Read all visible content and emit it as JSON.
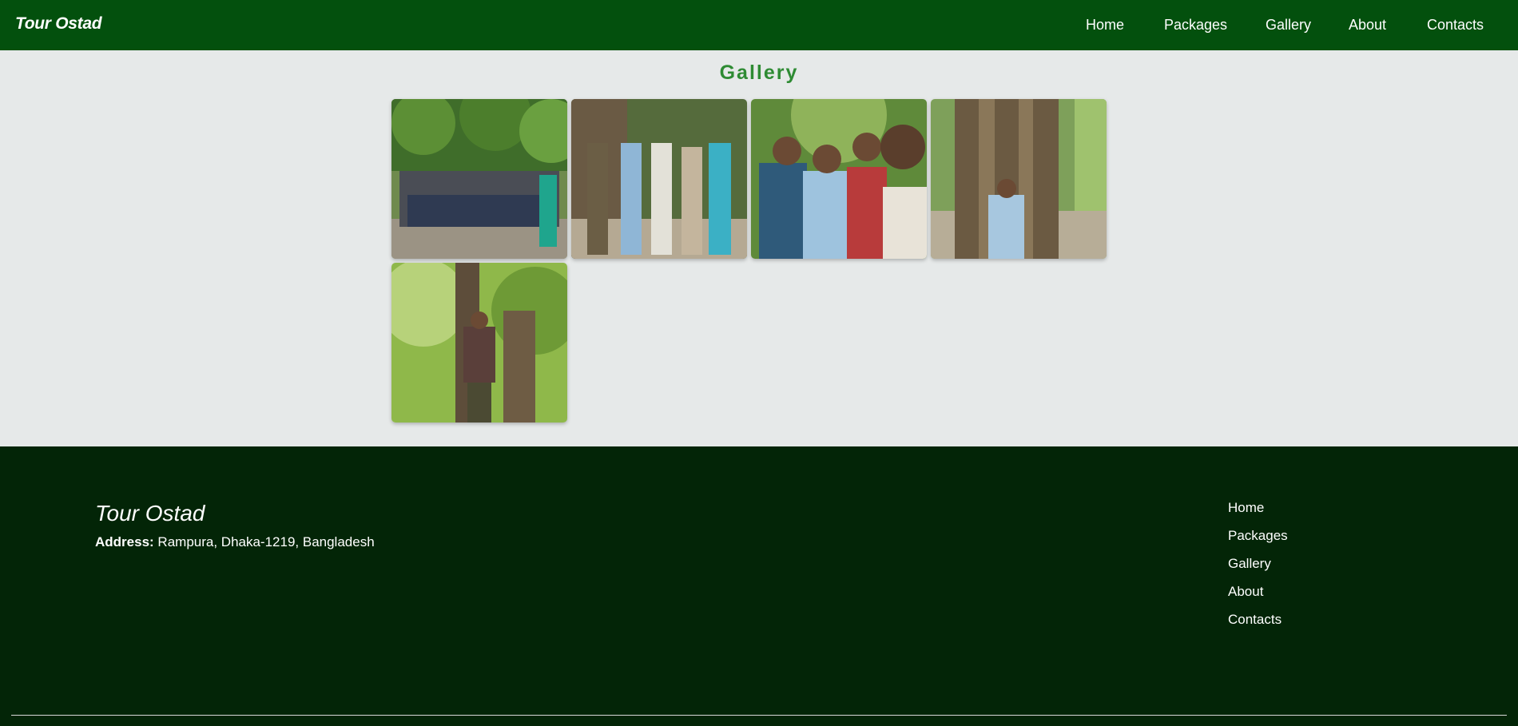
{
  "navbar": {
    "brand": "Tour Ostad",
    "links": [
      "Home",
      "Packages",
      "Gallery",
      "About",
      "Contacts"
    ]
  },
  "gallery": {
    "title": "Gallery"
  },
  "footer": {
    "brand": "Tour Ostad",
    "address_label": "Address:",
    "address_value": "Rampura, Dhaka-1219, Bangladesh",
    "links": [
      "Home",
      "Packages",
      "Gallery",
      "About",
      "Contacts"
    ]
  },
  "colors": {
    "navbar_bg": "#03500d",
    "page_bg": "#e6e9e9",
    "title_green": "#2e8b33",
    "footer_bg": "#032507"
  }
}
